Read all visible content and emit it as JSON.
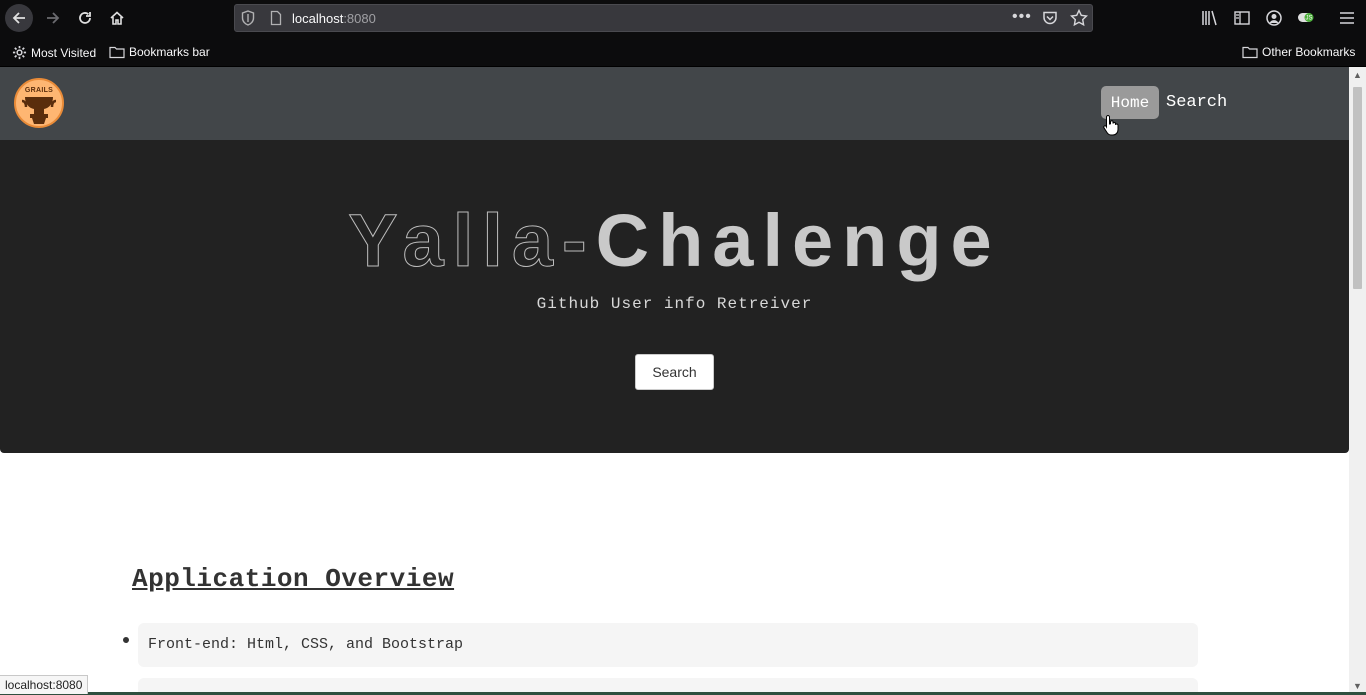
{
  "browser": {
    "url_host": "localhost",
    "url_port": ":8080",
    "bookmarks": [
      {
        "label": "Most Visited",
        "icon": "gear-icon"
      },
      {
        "label": "Bookmarks bar",
        "icon": "folder-icon"
      }
    ],
    "other_bookmarks": "Other Bookmarks",
    "status_text": "localhost:8080"
  },
  "navbar": {
    "logo_text": "GRAILS",
    "home_label": "Home",
    "search_label": "Search"
  },
  "hero": {
    "title_part1": "Yalla-",
    "title_part2": "Chalenge",
    "subtitle": "Github User info Retreiver",
    "button_label": "Search"
  },
  "overview": {
    "title": "Application Overview",
    "items": [
      "Front-end: Html, CSS, and Bootstrap"
    ]
  }
}
